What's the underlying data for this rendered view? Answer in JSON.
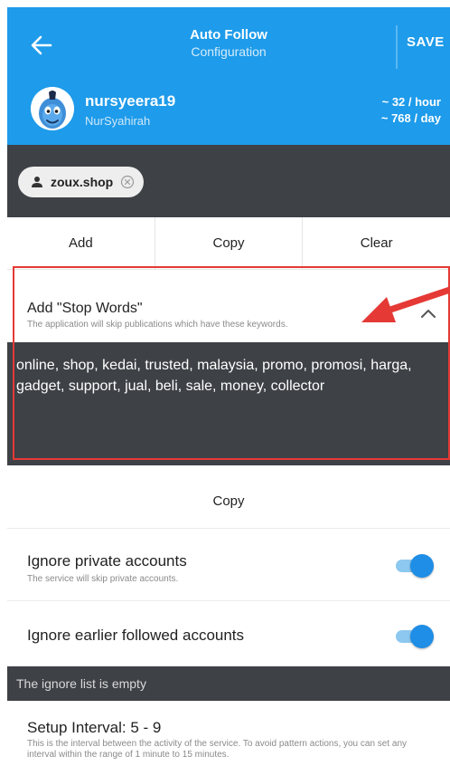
{
  "header": {
    "title": "Auto Follow",
    "subtitle": "Configuration",
    "save_label": "SAVE"
  },
  "account": {
    "username": "nursyeera19",
    "full_name": "NurSyahirah",
    "rate_hour": "~ 32 / hour",
    "rate_day": "~ 768 / day"
  },
  "tags": [
    {
      "label": "zoux.shop"
    }
  ],
  "actions": {
    "add": "Add",
    "copy": "Copy",
    "clear": "Clear"
  },
  "stop_words": {
    "title": "Add \"Stop Words\"",
    "description": "The application will skip publications which have these keywords.",
    "words": "online, shop, kedai, trusted, malaysia, promo, promosi, harga, gadget, support, jual, beli, sale, money, collector",
    "copy_label": "Copy"
  },
  "settings": {
    "ignore_private": {
      "label": "Ignore private accounts",
      "description": "The service will skip private accounts.",
      "enabled": true
    },
    "ignore_followed": {
      "label": "Ignore earlier followed accounts",
      "enabled": true
    }
  },
  "ignore_list": {
    "status": "The ignore list is empty"
  },
  "interval": {
    "label": "Setup Interval: 5 - 9",
    "description": "This is the interval between the activity of the service. To avoid pattern actions, you can set any interval within the range of 1 minute to 15 minutes."
  },
  "colors": {
    "primary": "#1e9bea",
    "dark_panel": "#3e4146",
    "switch_on": "#1e8ee6",
    "annotation": "#e53935"
  }
}
